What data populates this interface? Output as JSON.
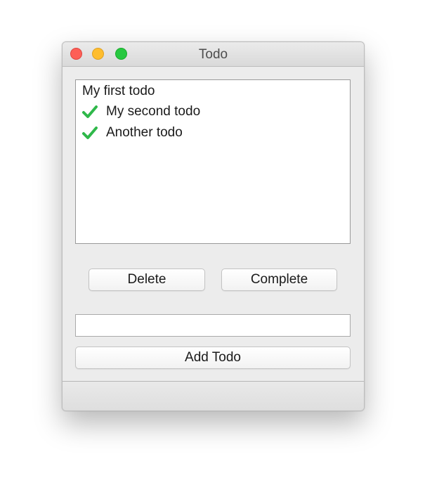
{
  "window": {
    "title": "Todo"
  },
  "todos": [
    {
      "text": "My first todo",
      "completed": false
    },
    {
      "text": "My second todo",
      "completed": true
    },
    {
      "text": "Another todo",
      "completed": true
    }
  ],
  "buttons": {
    "delete_label": "Delete",
    "complete_label": "Complete",
    "add_label": "Add Todo"
  },
  "new_todo": {
    "value": "",
    "placeholder": ""
  },
  "icons": {
    "check": "checkmark-icon"
  },
  "colors": {
    "close": "#fd5f57",
    "minimize": "#febd2e",
    "zoom": "#27c840",
    "check": "#2fb84a"
  }
}
